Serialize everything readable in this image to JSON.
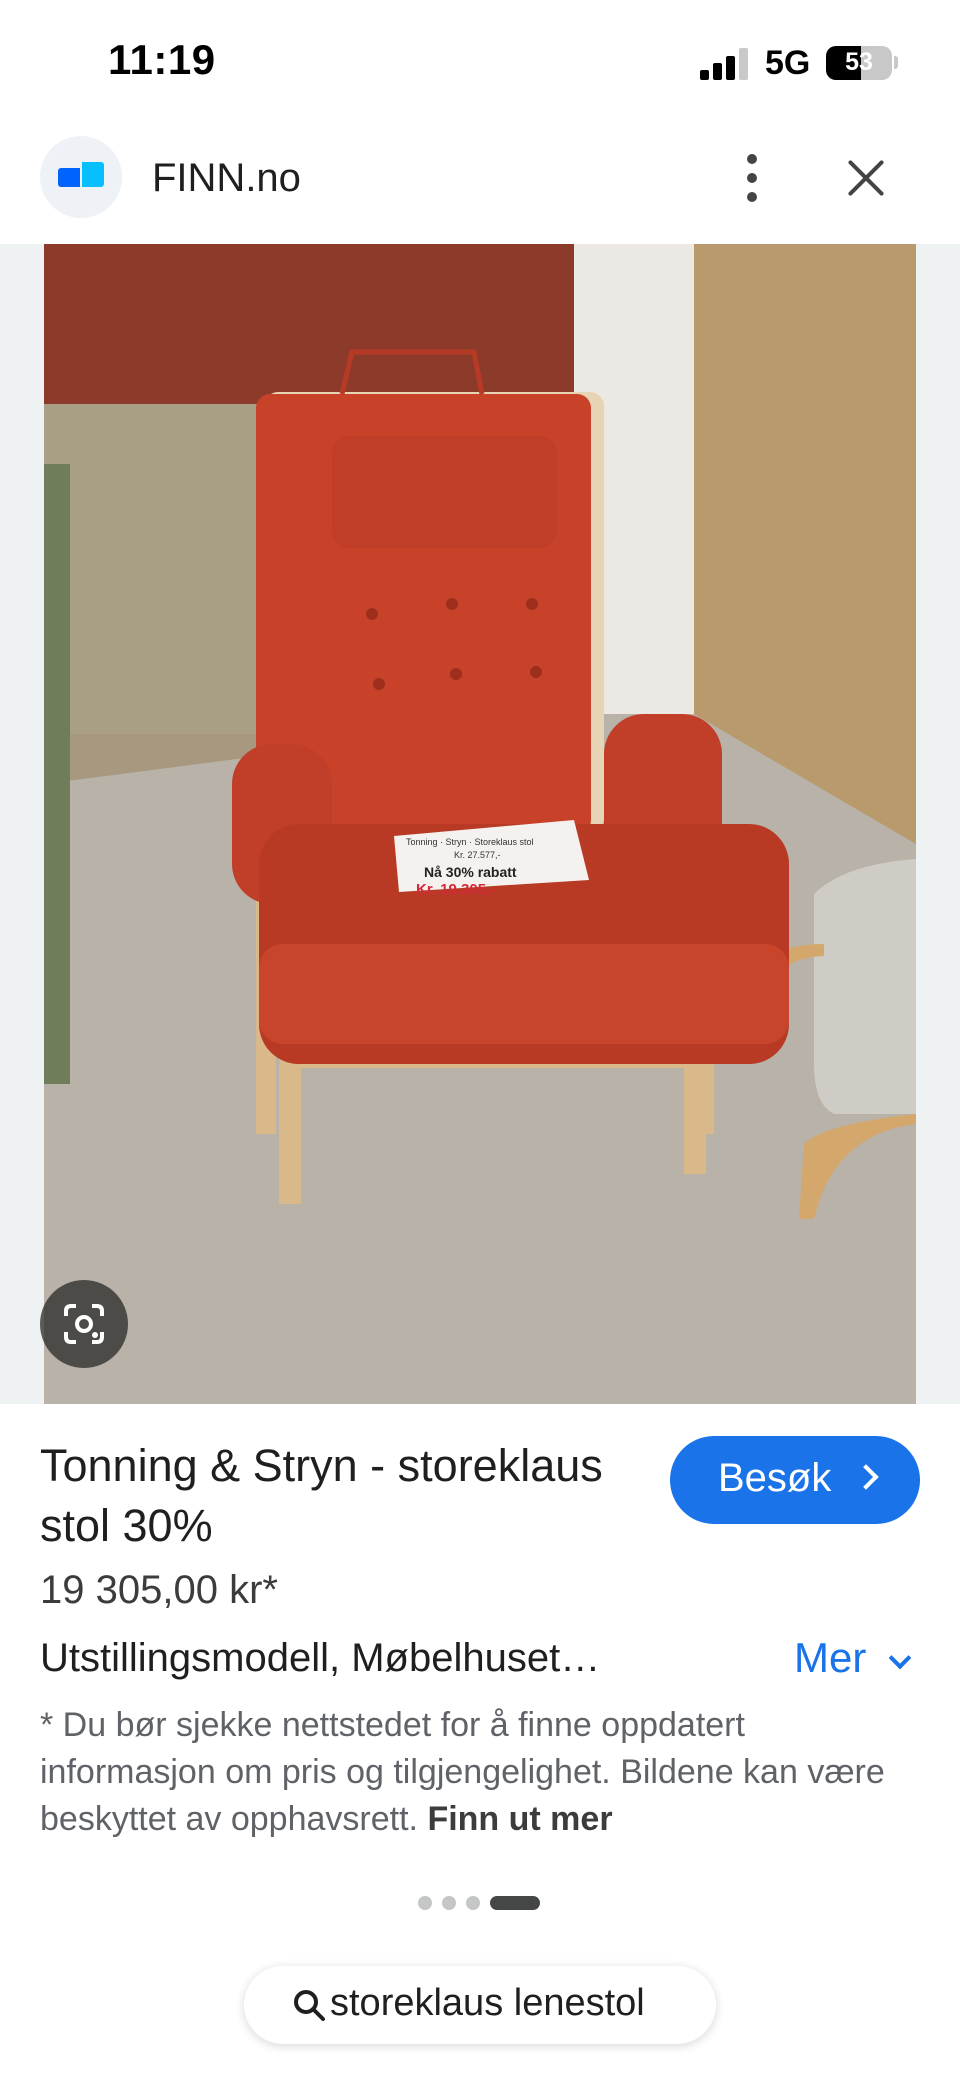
{
  "status_bar": {
    "time": "11:19",
    "network": "5G",
    "battery": "53",
    "battery_level": 0.53
  },
  "header": {
    "site_name": "FINN.no",
    "logo_icon": "finn-logo-icon",
    "more_icon": "more-vert-icon",
    "close_icon": "close-icon"
  },
  "image": {
    "lens_icon": "google-lens-icon",
    "sign_lines": [
      "Tonning · Stryn · Storeklaus stol",
      "Kr. 27.577,-",
      "Nå 30% rabatt",
      "Kr. 19.305,-"
    ]
  },
  "product": {
    "title": "Tonning & Stryn - storeklaus stol 30%",
    "visit_label": "Besøk",
    "price": "19 305,00 kr*",
    "description": "Utstillingsmodell, Møbelhuset…",
    "more_label": "Mer",
    "disclaimer": "* Du bør sjekke nettstedet for å finne oppdatert informasjon om pris og tilgjengelighet. Bildene kan være beskyttet av opphavsrett.",
    "learn_more": "Finn ut mer"
  },
  "pager": {
    "count": 4,
    "active": 4
  },
  "search": {
    "query": "storeklaus lenestol",
    "icon": "search-icon"
  },
  "colors": {
    "accent": "#1a73e8",
    "chair": "#c8422a",
    "wood": "#d9b98a"
  }
}
